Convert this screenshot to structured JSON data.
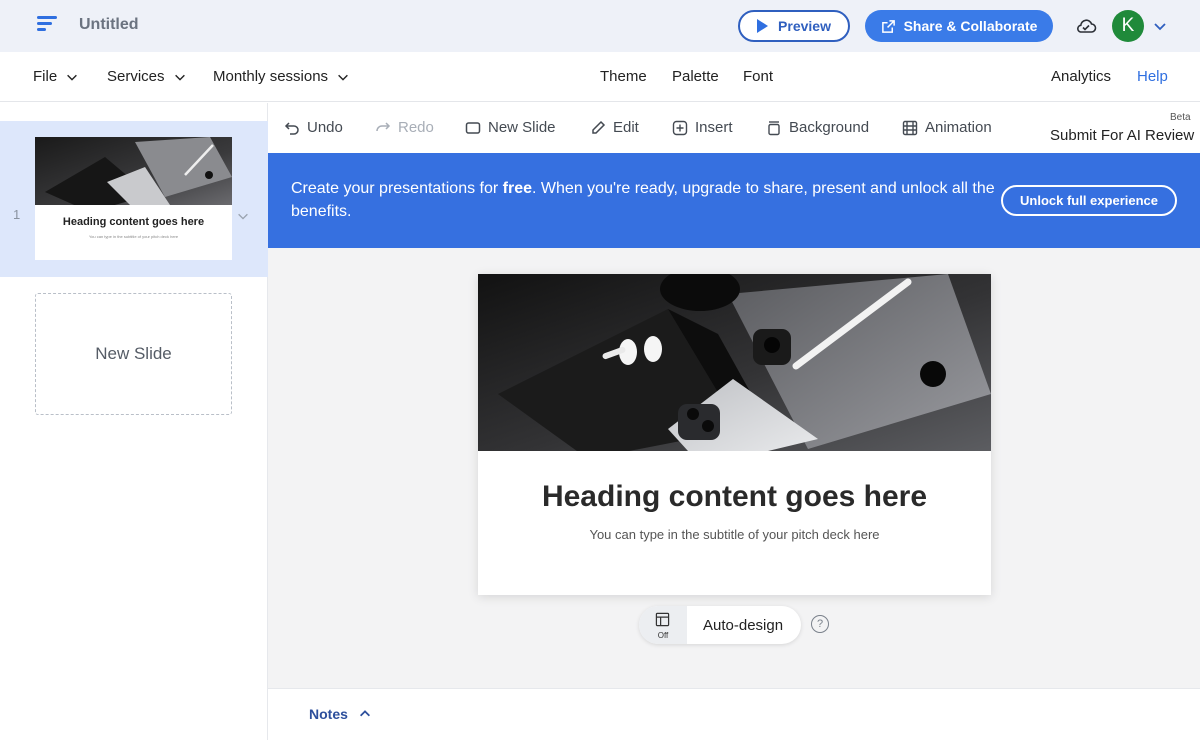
{
  "topbar": {
    "doc_title": "Untitled",
    "preview_label": "Preview",
    "share_label": "Share & Collaborate",
    "avatar_initial": "K",
    "avatar_color": "#1f8a3a"
  },
  "menu": {
    "file": "File",
    "services": "Services",
    "monthly_sessions": "Monthly sessions",
    "theme": "Theme",
    "palette": "Palette",
    "font": "Font",
    "analytics": "Analytics",
    "help": "Help"
  },
  "toolbar": {
    "undo": "Undo",
    "redo": "Redo",
    "new_slide": "New Slide",
    "edit": "Edit",
    "insert": "Insert",
    "background": "Background",
    "animation": "Animation",
    "beta": "Beta",
    "ai_review": "Submit For AI Review"
  },
  "banner": {
    "text_before": "Create your presentations for ",
    "text_bold": "free",
    "text_after": ". When you're ready, upgrade to share, present and unlock all the benefits.",
    "unlock_label": "Unlock full experience"
  },
  "sidebar": {
    "slides": [
      {
        "number": "1",
        "heading": "Heading content goes here",
        "subtitle": "You can type in the subtitle of your pitch deck here"
      }
    ],
    "new_slide_label": "New Slide"
  },
  "slide": {
    "heading": "Heading content goes here",
    "subtitle": "You can type in the subtitle of your pitch deck here"
  },
  "autodesign": {
    "state": "Off",
    "label": "Auto-design",
    "help": "?"
  },
  "notes": {
    "label": "Notes"
  },
  "colors": {
    "accent": "#3670e0",
    "topbar_bg": "#eef1f8",
    "selected_slide_bg": "#dde7fb"
  }
}
